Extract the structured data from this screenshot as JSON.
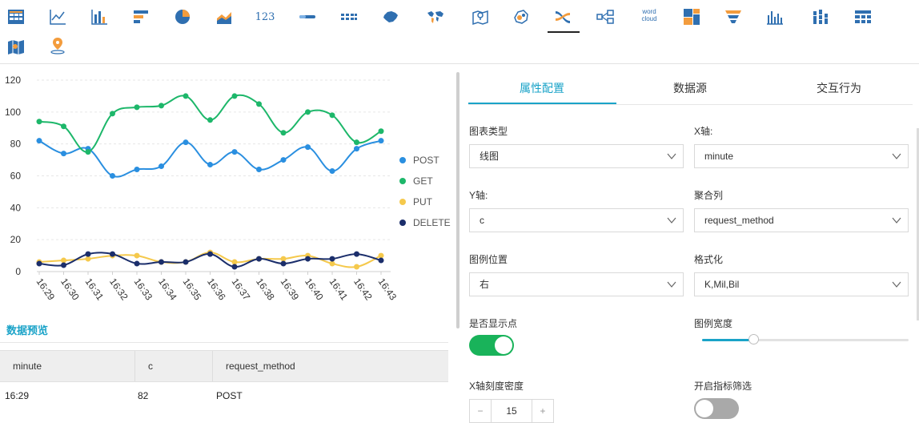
{
  "toolbar": {
    "icons": [
      "table-icon",
      "line-chart-icon",
      "bar-chart-icon",
      "horizontal-bar-icon",
      "pie-chart-icon",
      "area-chart-icon",
      "kpi-number-icon",
      "progress-bar-icon",
      "indicator-dots-icon",
      "china-map-icon",
      "world-map-icon",
      "location-map-icon",
      "bubble-map-icon",
      "sankey-icon",
      "flow-diagram-icon",
      "word-cloud-icon",
      "treemap-icon",
      "funnel-icon",
      "column-chart-icon",
      "stacked-column-icon",
      "pivot-table-icon",
      "map-icon",
      "geo-pin-icon"
    ],
    "kpi_text": "123",
    "wordcloud_top": "word",
    "wordcloud_bottom": "cloud"
  },
  "chart_data": {
    "type": "line",
    "categories": [
      "16:29",
      "16:30",
      "16:31",
      "16:32",
      "16:33",
      "16:34",
      "16:35",
      "16:36",
      "16:37",
      "16:38",
      "16:39",
      "16:40",
      "16:41",
      "16:42",
      "16:43"
    ],
    "ylim": [
      0,
      120
    ],
    "yticks": [
      0,
      20,
      40,
      60,
      80,
      100,
      120
    ],
    "grid": true,
    "legend_position": "right",
    "series": [
      {
        "name": "POST",
        "color": "#2a8fe0",
        "values": [
          82,
          74,
          77,
          60,
          64,
          66,
          81,
          67,
          75,
          64,
          70,
          78,
          63,
          77,
          82
        ]
      },
      {
        "name": "GET",
        "color": "#1db76a",
        "values": [
          94,
          91,
          75,
          99,
          103,
          104,
          110,
          95,
          110,
          105,
          87,
          100,
          98,
          81,
          88
        ]
      },
      {
        "name": "PUT",
        "color": "#f5c94c",
        "values": [
          6,
          7,
          8,
          10,
          10,
          6,
          6,
          12,
          6,
          8,
          8,
          10,
          5,
          3,
          10
        ]
      },
      {
        "name": "DELETE",
        "color": "#1b2e6b",
        "values": [
          5,
          4,
          11,
          11,
          5,
          6,
          6,
          11,
          3,
          8,
          5,
          8,
          8,
          11,
          7
        ]
      }
    ]
  },
  "preview": {
    "title": "数据预览",
    "columns": [
      "minute",
      "c",
      "request_method"
    ],
    "rows": [
      [
        "16:29",
        "82",
        "POST"
      ]
    ]
  },
  "panel": {
    "tabs": [
      "属性配置",
      "数据源",
      "交互行为"
    ],
    "chart_type_label": "图表类型",
    "chart_type_value": "线图",
    "x_axis_label": "X轴:",
    "x_axis_value": "minute",
    "y_axis_label": "Y轴:",
    "y_axis_value": "c",
    "agg_label": "聚合列",
    "agg_value": "request_method",
    "legend_pos_label": "图例位置",
    "legend_pos_value": "右",
    "format_label": "格式化",
    "format_value": "K,Mil,Bil",
    "show_points_label": "是否显示点",
    "show_points_on": true,
    "legend_width_label": "图例宽度",
    "legend_width_fraction": 0.25,
    "x_density_label": "X轴刻度密度",
    "x_density_value": "15",
    "metric_filter_label": "开启指标筛选",
    "metric_filter_on": false
  }
}
